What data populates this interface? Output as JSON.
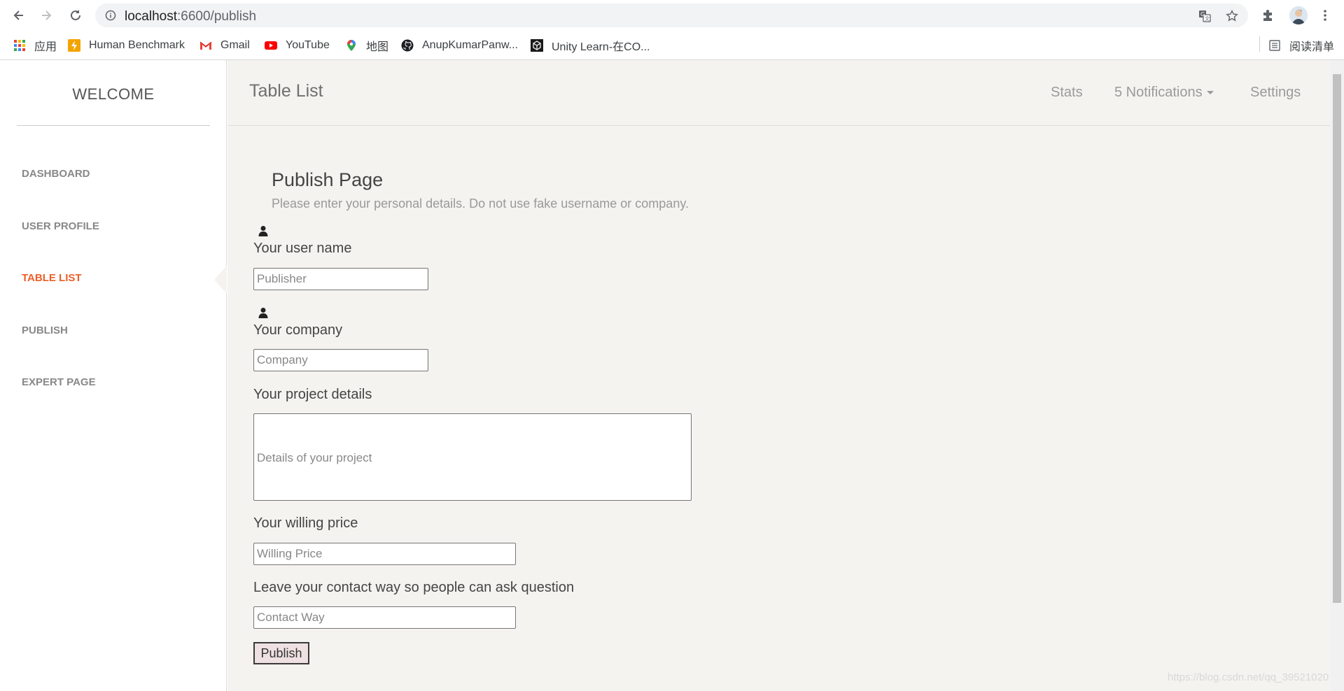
{
  "browser": {
    "url_host": "localhost",
    "url_path": ":6600/publish",
    "bookmarks": [
      {
        "label": "应用",
        "icon": "apps-grid-icon"
      },
      {
        "label": "Human Benchmark",
        "icon": "lightning-icon"
      },
      {
        "label": "Gmail",
        "icon": "gmail-icon"
      },
      {
        "label": "YouTube",
        "icon": "youtube-icon"
      },
      {
        "label": "地图",
        "icon": "maps-pin-icon"
      },
      {
        "label": "AnupKumarPanw...",
        "icon": "github-icon"
      },
      {
        "label": "Unity Learn-在CO...",
        "icon": "unity-icon"
      }
    ],
    "reading_list": "阅读清单"
  },
  "sidebar": {
    "brand": "WELCOME",
    "items": [
      {
        "label": "DASHBOARD",
        "active": false
      },
      {
        "label": "USER PROFILE",
        "active": false
      },
      {
        "label": "TABLE LIST",
        "active": true
      },
      {
        "label": "PUBLISH",
        "active": false
      },
      {
        "label": "EXPERT PAGE",
        "active": false
      }
    ]
  },
  "topbar": {
    "title": "Table List",
    "nav": {
      "stats": "Stats",
      "notifications": "5 Notifications",
      "settings": "Settings"
    }
  },
  "form": {
    "title": "Publish Page",
    "subtitle": "Please enter your personal details. Do not use fake username or company.",
    "username": {
      "label": "Your user name",
      "placeholder": "Publisher"
    },
    "company": {
      "label": "Your company",
      "placeholder": "Company"
    },
    "details": {
      "label": "Your project details",
      "placeholder": "Details of your project"
    },
    "price": {
      "label": "Your willing price",
      "placeholder": "Willing Price"
    },
    "contact": {
      "label": "Leave your contact way so people can ask question",
      "placeholder": "Contact Way"
    },
    "submit_label": "Publish"
  },
  "watermark": "https://blog.csdn.net/qq_39521020",
  "colors": {
    "accent": "#eb5e28",
    "content_bg": "#f4f3ef",
    "button_bg": "#efe1e1"
  }
}
